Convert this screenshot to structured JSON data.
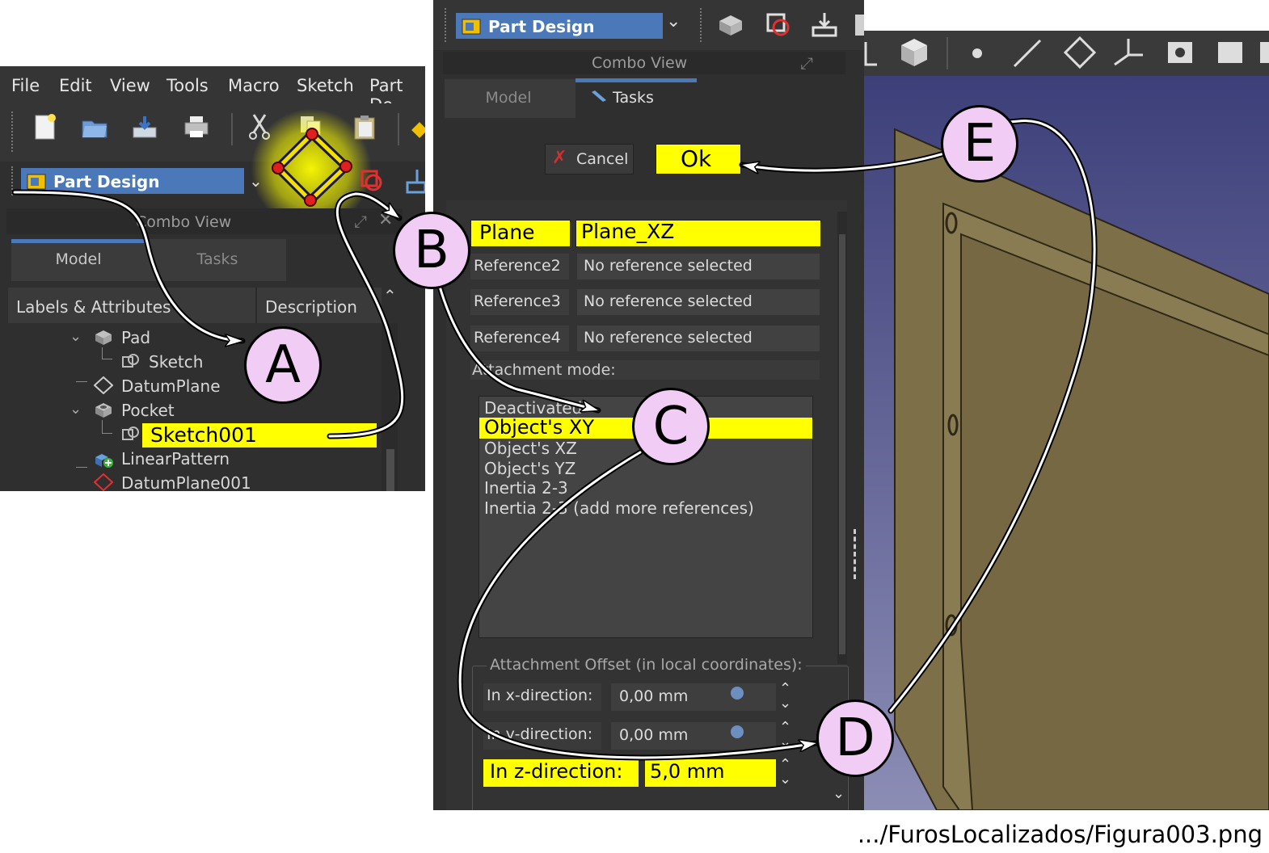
{
  "menubar": {
    "items": [
      "File",
      "Edit",
      "View",
      "Tools",
      "Macro",
      "Sketch",
      "Part De"
    ]
  },
  "workbench": {
    "label": "Part Design"
  },
  "combo_view": {
    "title": "Combo View"
  },
  "tabs": {
    "model": "Model",
    "tasks": "Tasks"
  },
  "tree": {
    "header_labels": "Labels & Attributes",
    "header_description": "Description",
    "items": [
      "Pad",
      "Sketch",
      "DatumPlane",
      "Pocket",
      "Sketch001",
      "LinearPattern",
      "DatumPlane001"
    ]
  },
  "task_buttons": {
    "cancel": "Cancel",
    "ok": "Ok"
  },
  "attachment": {
    "plane_label": "Plane",
    "plane_value": "Plane_XZ",
    "references": [
      {
        "label": "Reference2",
        "value": "No reference selected"
      },
      {
        "label": "Reference3",
        "value": "No reference selected"
      },
      {
        "label": "Reference4",
        "value": "No reference selected"
      }
    ],
    "mode_label": "Attachment mode:",
    "modes": [
      "Deactivated",
      "Object's XY",
      "Object's XZ",
      "Object's YZ",
      "Inertia 2-3",
      "Inertia 2-3 (add more references)"
    ],
    "selected_mode": "Object's XY"
  },
  "offset": {
    "title": "Attachment Offset (in local coordinates):",
    "x_label": "In x-direction:",
    "x_value": "0,00 mm",
    "y_label": "In y-direction:",
    "y_value": "0,00 mm",
    "z_label": "In z-direction:",
    "z_value": "5,0 mm"
  },
  "callouts": {
    "a": "A",
    "b": "B",
    "c": "C",
    "d": "D",
    "e": "E"
  },
  "caption": ".../FurosLocalizados/Figura003.png",
  "colors": {
    "highlight": "#ffff00",
    "callout_fill": "#f1ccf5",
    "panel_bg": "#2f2f2f",
    "workbench_blue": "#4a78b8",
    "viewport_top": "#3d3f7a",
    "viewport_bottom": "#8c8db5",
    "part_fill": "#7d7048"
  },
  "icons": [
    "new-icon",
    "open-icon",
    "save-icon",
    "print-icon",
    "cut-icon",
    "copy-icon",
    "paste-icon",
    "datum-plane-icon",
    "pad-icon",
    "sketch-icon",
    "pocket-icon",
    "linear-pattern-icon",
    "cancel-x-icon"
  ]
}
